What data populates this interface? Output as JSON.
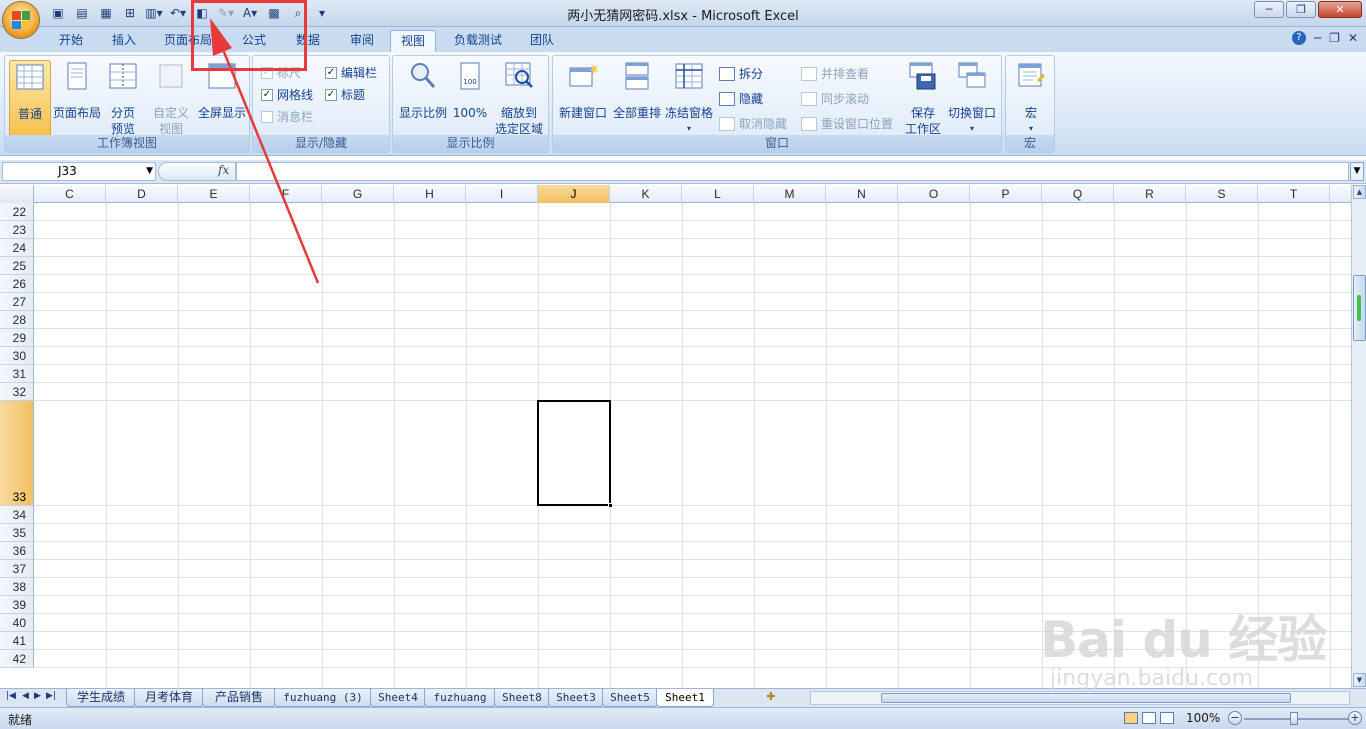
{
  "title": "两小无猜网密码.xlsx - Microsoft Excel",
  "qat": {
    "icons": [
      "save-icon",
      "open-icon",
      "print-preview-icon",
      "spell-icon",
      "form-icon",
      "undo-icon",
      "page-setup-icon",
      "draw-icon",
      "font-color-icon",
      "table-icon",
      "zoom-icon",
      "customize-icon"
    ]
  },
  "tabs": [
    "开始",
    "插入",
    "页面布局",
    "公式",
    "数据",
    "审阅",
    "视图",
    "负载测试",
    "团队"
  ],
  "active_tab": "视图",
  "ribbon": {
    "workbook_views": {
      "name": "工作簿视图",
      "normal": "普通",
      "page_layout": "页面布局",
      "page_break_1": "分页",
      "page_break_2": "预览",
      "custom_1": "自定义",
      "custom_2": "视图",
      "fullscreen": "全屏显示"
    },
    "show_hide": {
      "name": "显示/隐藏",
      "ruler": "标尺",
      "gridlines": "网格线",
      "message_bar": "消息栏",
      "formula_bar": "编辑栏",
      "headings": "标题"
    },
    "zoom": {
      "name": "显示比例",
      "zoom": "显示比例",
      "hundred": "100%",
      "zoom_sel_1": "缩放到",
      "zoom_sel_2": "选定区域"
    },
    "window": {
      "name": "窗口",
      "new_window": "新建窗口",
      "arrange_all": "全部重排",
      "freeze": "冻结窗格",
      "split": "拆分",
      "hide": "隐藏",
      "unhide": "取消隐藏",
      "side_by_side": "并排查看",
      "sync_scroll": "同步滚动",
      "reset_pos": "重设窗口位置",
      "save_ws_1": "保存",
      "save_ws_2": "工作区",
      "switch": "切换窗口"
    },
    "macros": {
      "name": "宏",
      "macros": "宏"
    }
  },
  "formula_bar": {
    "name_box": "J33",
    "fx": "fx",
    "value": ""
  },
  "columns": [
    "C",
    "D",
    "E",
    "F",
    "G",
    "H",
    "I",
    "J",
    "K",
    "L",
    "M",
    "N",
    "O",
    "P",
    "Q",
    "R",
    "S",
    "T"
  ],
  "selected_column": "J",
  "rows": [
    "22",
    "23",
    "24",
    "25",
    "26",
    "27",
    "28",
    "29",
    "30",
    "31",
    "32",
    "33",
    "34",
    "35",
    "36",
    "37",
    "38",
    "39",
    "40",
    "41",
    "42"
  ],
  "selected_row": "33",
  "sheets": [
    "学生成绩",
    "月考体育",
    "产品销售",
    "fuzhuang (3)",
    "Sheet4",
    "fuzhuang",
    "Sheet8",
    "Sheet3",
    "Sheet5",
    "Sheet1"
  ],
  "active_sheet": "Sheet1",
  "status": {
    "text": "就绪",
    "zoom": "100%"
  },
  "watermark": {
    "brand": "Bai du 经验",
    "url": "jingyan.baidu.com"
  },
  "colors": {
    "annotation": "#e8393b",
    "accent": "#f1c15f"
  }
}
